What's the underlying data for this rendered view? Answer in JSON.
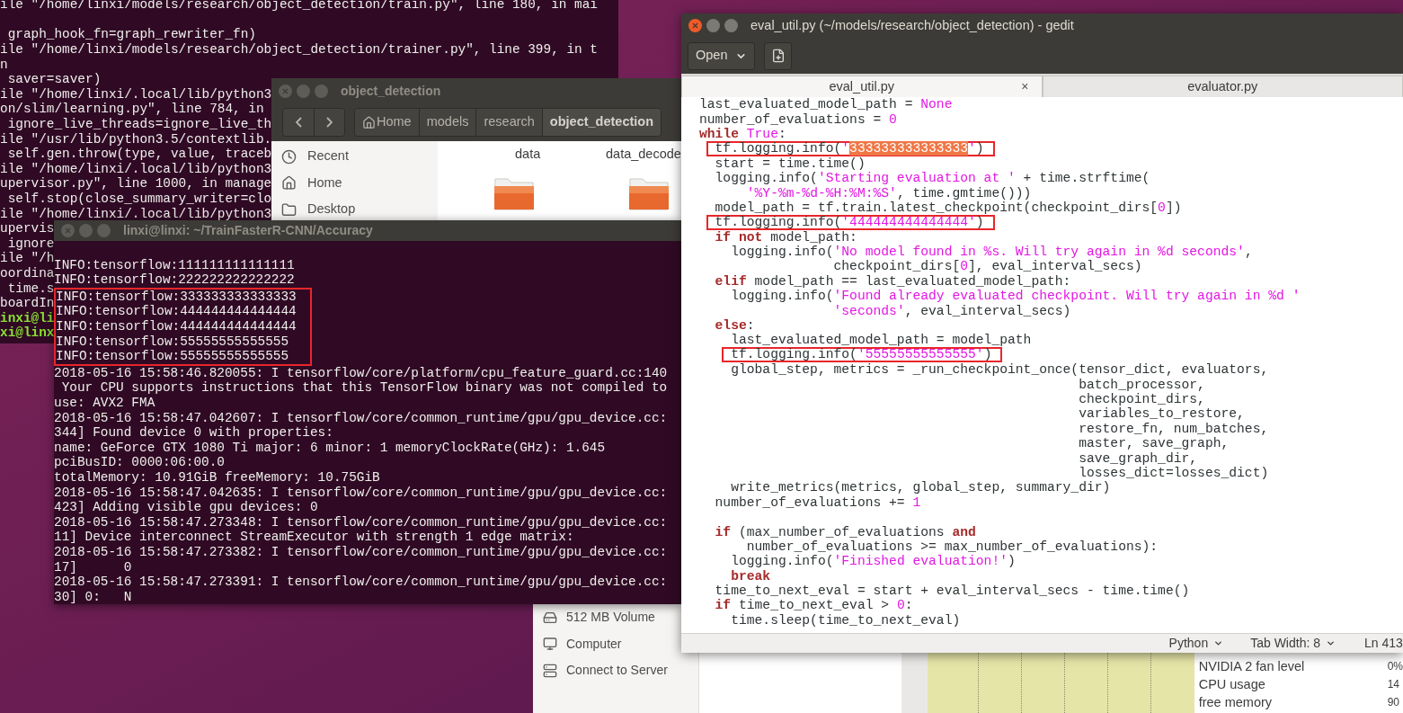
{
  "back_terminal": {
    "lines": [
      {
        "text": "ile \"/home/linxi/models/research/object_detection/train.py\", line 180, in mai",
        "kind": "output"
      },
      {
        "kind": "blank"
      },
      {
        "text": " graph_hook_fn=graph_rewriter_fn)",
        "kind": "output"
      },
      {
        "text": "ile \"/home/linxi/models/research/object_detection/trainer.py\", line 399, in t",
        "kind": "output"
      },
      {
        "text": "n",
        "kind": "output"
      },
      {
        "text": " saver=saver)",
        "kind": "output"
      },
      {
        "text": "ile \"/home/linxi/.local/lib/python3",
        "kind": "output"
      },
      {
        "text": "on/slim/learning.py\", line 784, in",
        "kind": "output"
      },
      {
        "text": " ignore_live_threads=ignore_live_th",
        "kind": "output"
      },
      {
        "text": "ile \"/usr/lib/python3.5/contextlib.",
        "kind": "output"
      },
      {
        "text": " self.gen.throw(type, value, traceb",
        "kind": "output"
      },
      {
        "text": "ile \"/home/linxi/.local/lib/python3",
        "kind": "output"
      },
      {
        "text": "upervisor.py\", line 1000, in manage",
        "kind": "output"
      },
      {
        "text": " self.stop(close_summary_writer=clo",
        "kind": "output"
      },
      {
        "text": "ile \"/home/linxi/.local/lib/python3",
        "kind": "output"
      },
      {
        "text": "upervis",
        "kind": "output"
      },
      {
        "text": " ignore",
        "kind": "output"
      },
      {
        "text": "ile \"/h",
        "kind": "output"
      },
      {
        "text": "oordina",
        "kind": "output"
      },
      {
        "text": " time.s",
        "kind": "output"
      },
      {
        "text": "boardIn",
        "kind": "output"
      },
      {
        "text": "inxi@li",
        "kind": "prompt"
      },
      {
        "text": "xi@linx",
        "kind": "prompt"
      }
    ]
  },
  "file_manager": {
    "title": "object_detection",
    "path": [
      {
        "label": "Home",
        "selected": false
      },
      {
        "label": "models",
        "selected": false
      },
      {
        "label": "research",
        "selected": false
      },
      {
        "label": "object_detection",
        "selected": true
      }
    ],
    "places": [
      {
        "label": "Recent"
      },
      {
        "label": "Home"
      },
      {
        "label": "Desktop"
      }
    ],
    "files": [
      {
        "label": "data"
      },
      {
        "label": "data_decode"
      }
    ]
  },
  "terminal": {
    "title": "linxi@linxi: ~/TrainFasterR-CNN/Accuracy",
    "lines": [
      {
        "text": "INFO:tensorflow:111111111111111",
        "boxed": false
      },
      {
        "text": "INFO:tensorflow:222222222222222",
        "boxed": false
      },
      {
        "text": "INFO:tensorflow:333333333333333",
        "boxed": true
      },
      {
        "text": "INFO:tensorflow:444444444444444",
        "boxed": true
      },
      {
        "text": "INFO:tensorflow:444444444444444",
        "boxed": true
      },
      {
        "text": "INFO:tensorflow:55555555555555",
        "boxed": true
      },
      {
        "text": "INFO:tensorflow:55555555555555",
        "boxed": true
      },
      {
        "text": "2018-05-16 15:58:46.820055: I tensorflow/core/platform/cpu_feature_guard.cc:140",
        "boxed": false
      },
      {
        "text": " Your CPU supports instructions that this TensorFlow binary was not compiled to",
        "boxed": false
      },
      {
        "text": "use: AVX2 FMA",
        "boxed": false
      },
      {
        "text": "2018-05-16 15:58:47.042607: I tensorflow/core/common_runtime/gpu/gpu_device.cc:",
        "boxed": false
      },
      {
        "text": "344] Found device 0 with properties:",
        "boxed": false
      },
      {
        "text": "name: GeForce GTX 1080 Ti major: 6 minor: 1 memoryClockRate(GHz): 1.645",
        "boxed": false
      },
      {
        "text": "pciBusID: 0000:06:00.0",
        "boxed": false
      },
      {
        "text": "totalMemory: 10.91GiB freeMemory: 10.75GiB",
        "boxed": false
      },
      {
        "text": "2018-05-16 15:58:47.042635: I tensorflow/core/common_runtime/gpu/gpu_device.cc:",
        "boxed": false
      },
      {
        "text": "423] Adding visible gpu devices: 0",
        "boxed": false
      },
      {
        "text": "2018-05-16 15:58:47.273348: I tensorflow/core/common_runtime/gpu/gpu_device.cc:",
        "boxed": false
      },
      {
        "text": "11] Device interconnect StreamExecutor with strength 1 edge matrix:",
        "boxed": false
      },
      {
        "text": "2018-05-16 15:58:47.273382: I tensorflow/core/common_runtime/gpu/gpu_device.cc:",
        "boxed": false
      },
      {
        "text": "17]      0",
        "boxed": false
      },
      {
        "text": "2018-05-16 15:58:47.273391: I tensorflow/core/common_runtime/gpu/gpu_device.cc:",
        "boxed": false
      },
      {
        "text": "30] 0:   N",
        "boxed": false
      }
    ]
  },
  "editor": {
    "title": "eval_util.py (~/models/research/object_detection) - gedit",
    "open_button": "Open",
    "tabs": [
      {
        "label": "eval_util.py",
        "selected": true,
        "close": "×"
      },
      {
        "label": "evaluator.py",
        "selected": false
      }
    ],
    "lines": [
      {
        "kind": "code",
        "boxed": false,
        "segments": [
          {
            "text": "last_evaluated_model_path = ",
            "kind": "plain"
          },
          {
            "text": "None",
            "kind": "constant"
          }
        ]
      },
      {
        "kind": "code",
        "boxed": false,
        "segments": [
          {
            "text": "number_of_evaluations = ",
            "kind": "plain"
          },
          {
            "text": "0",
            "kind": "number"
          }
        ]
      },
      {
        "kind": "code",
        "boxed": false,
        "segments": [
          {
            "text": "while",
            "kind": "keyword"
          },
          {
            "text": " True",
            "kind": "constant"
          },
          {
            "text": ":",
            "kind": "plain"
          }
        ]
      },
      {
        "kind": "code",
        "boxed": true,
        "segments": [
          {
            "text": "  tf.logging.info(",
            "kind": "plain"
          },
          {
            "text": "'",
            "kind": "string"
          },
          {
            "text": "333333333333333",
            "kind": "selection"
          },
          {
            "text": "'",
            "kind": "string"
          },
          {
            "text": ")",
            "kind": "plain"
          }
        ]
      },
      {
        "kind": "code",
        "boxed": false,
        "segments": [
          {
            "text": "  start = time.time()",
            "kind": "plain"
          }
        ]
      },
      {
        "kind": "code",
        "boxed": false,
        "segments": [
          {
            "text": "  logging.info(",
            "kind": "plain"
          },
          {
            "text": "'Starting evaluation at '",
            "kind": "string"
          },
          {
            "text": " + time.strftime(",
            "kind": "plain"
          }
        ]
      },
      {
        "kind": "code",
        "boxed": false,
        "segments": [
          {
            "text": "      '%Y-%m-%d-%H:%M:%S'",
            "kind": "string"
          },
          {
            "text": ", time.gmtime()))",
            "kind": "plain"
          }
        ]
      },
      {
        "kind": "code",
        "boxed": false,
        "segments": [
          {
            "text": "  model_path = tf.train.latest_checkpoint(checkpoint_dirs[",
            "kind": "plain"
          },
          {
            "text": "0",
            "kind": "number"
          },
          {
            "text": "])",
            "kind": "plain"
          }
        ]
      },
      {
        "kind": "code",
        "boxed": true,
        "segments": [
          {
            "text": "  tf.logging.info(",
            "kind": "plain"
          },
          {
            "text": "'444444444444444'",
            "kind": "string"
          },
          {
            "text": ")",
            "kind": "plain"
          }
        ]
      },
      {
        "kind": "code",
        "boxed": false,
        "segments": [
          {
            "text": "  if",
            "kind": "keyword"
          },
          {
            "text": " not",
            "kind": "keyword"
          },
          {
            "text": " model_path:",
            "kind": "plain"
          }
        ]
      },
      {
        "kind": "code",
        "boxed": false,
        "segments": [
          {
            "text": "    logging.info(",
            "kind": "plain"
          },
          {
            "text": "'No model found in %s. Will try again in %d seconds'",
            "kind": "string"
          },
          {
            "text": ",",
            "kind": "plain"
          }
        ]
      },
      {
        "kind": "code",
        "boxed": false,
        "segments": [
          {
            "text": "                 checkpoint_dirs[",
            "kind": "plain"
          },
          {
            "text": "0",
            "kind": "number"
          },
          {
            "text": "], eval_interval_secs)",
            "kind": "plain"
          }
        ]
      },
      {
        "kind": "code",
        "boxed": false,
        "segments": [
          {
            "text": "  elif",
            "kind": "keyword"
          },
          {
            "text": " model_path == last_evaluated_model_path:",
            "kind": "plain"
          }
        ]
      },
      {
        "kind": "code",
        "boxed": false,
        "segments": [
          {
            "text": "    logging.info(",
            "kind": "plain"
          },
          {
            "text": "'Found already evaluated checkpoint. Will try again in %d '",
            "kind": "string"
          }
        ]
      },
      {
        "kind": "code",
        "boxed": false,
        "segments": [
          {
            "text": "                 'seconds'",
            "kind": "string"
          },
          {
            "text": ", eval_interval_secs)",
            "kind": "plain"
          }
        ]
      },
      {
        "kind": "code",
        "boxed": false,
        "segments": [
          {
            "text": "  else",
            "kind": "keyword"
          },
          {
            "text": ":",
            "kind": "plain"
          }
        ]
      },
      {
        "kind": "code",
        "boxed": false,
        "segments": [
          {
            "text": "    last_evaluated_model_path = model_path",
            "kind": "plain"
          }
        ]
      },
      {
        "kind": "code",
        "boxed": true,
        "segments": [
          {
            "text": "    tf.logging.info(",
            "kind": "plain"
          },
          {
            "text": "'55555555555555'",
            "kind": "string"
          },
          {
            "text": ")",
            "kind": "plain"
          }
        ]
      },
      {
        "kind": "code",
        "boxed": false,
        "segments": [
          {
            "text": "    global_step, metrics = _run_checkpoint_once(tensor_dict, evaluators,",
            "kind": "plain"
          }
        ]
      },
      {
        "kind": "code",
        "boxed": false,
        "segments": [
          {
            "text": "                                                batch_processor,",
            "kind": "plain"
          }
        ]
      },
      {
        "kind": "code",
        "boxed": false,
        "segments": [
          {
            "text": "                                                checkpoint_dirs,",
            "kind": "plain"
          }
        ]
      },
      {
        "kind": "code",
        "boxed": false,
        "segments": [
          {
            "text": "                                                variables_to_restore,",
            "kind": "plain"
          }
        ]
      },
      {
        "kind": "code",
        "boxed": false,
        "segments": [
          {
            "text": "                                                restore_fn, num_batches,",
            "kind": "plain"
          }
        ]
      },
      {
        "kind": "code",
        "boxed": false,
        "segments": [
          {
            "text": "                                                master, save_graph,",
            "kind": "plain"
          }
        ]
      },
      {
        "kind": "code",
        "boxed": false,
        "segments": [
          {
            "text": "                                                save_graph_dir,",
            "kind": "plain"
          }
        ]
      },
      {
        "kind": "code",
        "boxed": false,
        "segments": [
          {
            "text": "                                                losses_dict=losses_dict)",
            "kind": "plain"
          }
        ]
      },
      {
        "kind": "code",
        "boxed": false,
        "segments": [
          {
            "text": "    write_metrics(metrics, global_step, summary_dir)",
            "kind": "plain"
          }
        ]
      },
      {
        "kind": "code",
        "boxed": false,
        "segments": [
          {
            "text": "  number_of_evaluations += ",
            "kind": "plain"
          },
          {
            "text": "1",
            "kind": "number"
          }
        ]
      },
      {
        "kind": "blank"
      },
      {
        "kind": "code",
        "boxed": false,
        "segments": [
          {
            "text": "  if",
            "kind": "keyword"
          },
          {
            "text": " (max_number_of_evaluations ",
            "kind": "plain"
          },
          {
            "text": "and",
            "kind": "keyword"
          }
        ]
      },
      {
        "kind": "code",
        "boxed": false,
        "segments": [
          {
            "text": "      number_of_evaluations >= max_number_of_evaluations):",
            "kind": "plain"
          }
        ]
      },
      {
        "kind": "code",
        "boxed": false,
        "segments": [
          {
            "text": "    logging.info(",
            "kind": "plain"
          },
          {
            "text": "'Finished evaluation!'",
            "kind": "string"
          },
          {
            "text": ")",
            "kind": "plain"
          }
        ]
      },
      {
        "kind": "code",
        "boxed": false,
        "segments": [
          {
            "text": "    break",
            "kind": "keyword"
          }
        ]
      },
      {
        "kind": "code",
        "boxed": false,
        "segments": [
          {
            "text": "  time_to_next_eval = start + eval_interval_secs - time.time()",
            "kind": "plain"
          }
        ]
      },
      {
        "kind": "code",
        "boxed": false,
        "segments": [
          {
            "text": "  if",
            "kind": "keyword"
          },
          {
            "text": " time_to_next_eval > ",
            "kind": "plain"
          },
          {
            "text": "0",
            "kind": "number"
          },
          {
            "text": ":",
            "kind": "plain"
          }
        ]
      },
      {
        "kind": "code",
        "boxed": false,
        "segments": [
          {
            "text": "    time.sleep(time_to_next_eval)",
            "kind": "plain"
          }
        ]
      }
    ],
    "status_bar": {
      "language": "Python",
      "tab_width": "Tab Width: 8",
      "position": "Ln 413"
    }
  },
  "file_manager_2": {
    "places": [
      {
        "label": "512 MB Volume"
      },
      {
        "label": "Computer"
      },
      {
        "label": "Connect to Server"
      }
    ]
  },
  "sensor_monitor": {
    "sensors": [
      {
        "name": "NVIDIA 2 fan level",
        "value": "0%"
      },
      {
        "name": "CPU usage",
        "value": "14"
      },
      {
        "name": "free memory",
        "value": "90"
      }
    ]
  }
}
